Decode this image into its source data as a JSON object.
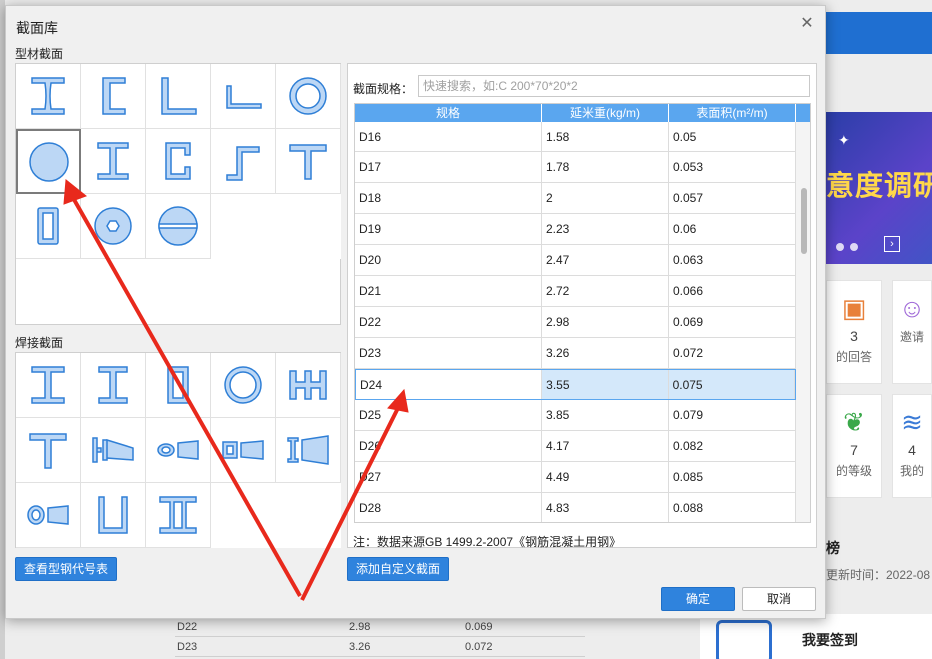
{
  "background": {
    "banner_text": "意度调研",
    "cards": [
      {
        "icon": "chat-bubble-icon",
        "num": "3",
        "label": "的回答"
      },
      {
        "icon": "person-icon",
        "num": "",
        "label": "邀请"
      },
      {
        "icon": "leaf-icon",
        "num": "7",
        "label": "的等级"
      },
      {
        "icon": "coins-icon",
        "num": "4",
        "label": "我的"
      }
    ],
    "rank_title": "榜",
    "rank_updated": "更新时间：2022-08",
    "sign_label": "我要签到",
    "table_rows": [
      {
        "spec": "D22",
        "weight": "2.98",
        "area": "0.069"
      },
      {
        "spec": "D23",
        "weight": "3.26",
        "area": "0.072"
      }
    ]
  },
  "dialog": {
    "title": "截面库",
    "profile_section_label": "型材截面",
    "welded_section_label": "焊接截面",
    "view_steel_codes_button": "查看型钢代号表",
    "add_custom_button": "添加自定义截面",
    "confirm_button": "确定",
    "cancel_button": "取消",
    "search_label": "截面规格：",
    "search_placeholder": "快速搜索，如:C 200*70*20*2",
    "table_headers": [
      "规格",
      "延米重(kg/m)",
      "表面积(m²/m)"
    ],
    "table_rows": [
      {
        "spec": "D16",
        "weight": "1.58",
        "area": "0.05"
      },
      {
        "spec": "D17",
        "weight": "1.78",
        "area": "0.053"
      },
      {
        "spec": "D18",
        "weight": "2",
        "area": "0.057"
      },
      {
        "spec": "D19",
        "weight": "2.23",
        "area": "0.06"
      },
      {
        "spec": "D20",
        "weight": "2.47",
        "area": "0.063"
      },
      {
        "spec": "D21",
        "weight": "2.72",
        "area": "0.066"
      },
      {
        "spec": "D22",
        "weight": "2.98",
        "area": "0.069"
      },
      {
        "spec": "D23",
        "weight": "3.26",
        "area": "0.072"
      },
      {
        "spec": "D24",
        "weight": "3.55",
        "area": "0.075"
      },
      {
        "spec": "D25",
        "weight": "3.85",
        "area": "0.079"
      },
      {
        "spec": "D26",
        "weight": "4.17",
        "area": "0.082"
      },
      {
        "spec": "D27",
        "weight": "4.49",
        "area": "0.085"
      },
      {
        "spec": "D28",
        "weight": "4.83",
        "area": "0.088"
      }
    ],
    "selected_row": "D24",
    "note": "注：数据来源GB 1499.2-2007《钢筋混凝土用钢》",
    "profile_shapes": [
      "i-beam-icon",
      "channel-icon",
      "angle-icon",
      "thin-angle-icon",
      "pipe-icon",
      "round-bar-icon",
      "h-beam-icon",
      "c-channel-icon",
      "z-section-icon",
      "t-section-icon",
      "rect-tube-icon",
      "hex-bar-icon",
      "half-sphere-icon"
    ],
    "welded_shapes": [
      "welded-i-beam-icon",
      "welded-h-beam-icon",
      "welded-box-icon",
      "welded-pipe-icon",
      "welded-cross-icon",
      "welded-t-icon",
      "tapered-i-icon",
      "tapered-pipe-icon",
      "tapered-box-icon",
      "tapered-h-icon",
      "tapered-ellipse-icon",
      "u-section-icon",
      "double-i-icon"
    ],
    "shape_fill": "#bcd7f5",
    "shape_stroke": "#2f7fd6",
    "accent": "#2f83dd"
  }
}
